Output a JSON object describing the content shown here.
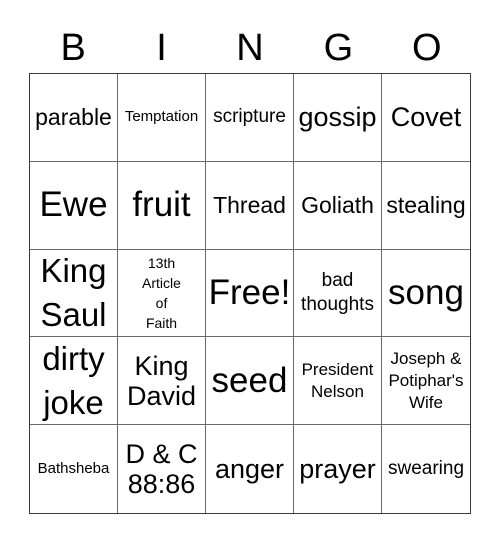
{
  "header": {
    "letters": [
      "B",
      "I",
      "N",
      "G",
      "O"
    ]
  },
  "cells": [
    {
      "text": "parable",
      "size": "s24"
    },
    {
      "text": "Temptation",
      "size": "s15"
    },
    {
      "text": "scripture",
      "size": "s20"
    },
    {
      "text": "gossip",
      "size": "s28"
    },
    {
      "text": "Covet",
      "size": "s28"
    },
    {
      "text": "Ewe",
      "size": "s36"
    },
    {
      "text": "fruit",
      "size": "s36"
    },
    {
      "text": "Thread",
      "size": "s24"
    },
    {
      "text": "Goliath",
      "size": "s24"
    },
    {
      "text": "stealing",
      "size": "s24"
    },
    {
      "text": "King\nSaul",
      "size": "s34"
    },
    {
      "text": "13th\nArticle\nof\nFaith",
      "size": "s14"
    },
    {
      "text": "Free!",
      "size": "s36"
    },
    {
      "text": "bad\nthoughts",
      "size": "s20"
    },
    {
      "text": "song",
      "size": "s36"
    },
    {
      "text": "dirty\njoke",
      "size": "s34"
    },
    {
      "text": "King\nDavid",
      "size": "s28"
    },
    {
      "text": "seed",
      "size": "s36"
    },
    {
      "text": "President\nNelson",
      "size": "s17"
    },
    {
      "text": "Joseph &\nPotiphar's\nWife",
      "size": "s17"
    },
    {
      "text": "Bathsheba",
      "size": "s15"
    },
    {
      "text": "D & C\n88:86",
      "size": "s28"
    },
    {
      "text": "anger",
      "size": "s28"
    },
    {
      "text": "prayer",
      "size": "s28"
    },
    {
      "text": "swearing",
      "size": "s20"
    }
  ]
}
